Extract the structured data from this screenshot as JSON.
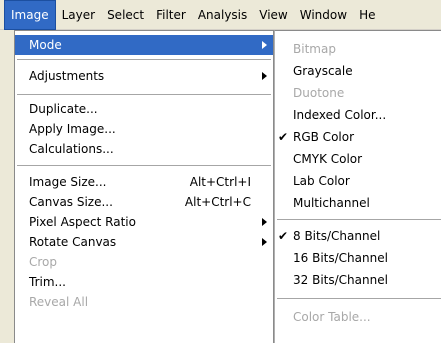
{
  "menubar": {
    "items": [
      "Image",
      "Layer",
      "Select",
      "Filter",
      "Analysis",
      "View",
      "Window",
      "He"
    ]
  },
  "image_menu": {
    "items": [
      {
        "label": "Mode"
      },
      {
        "label": "Adjustments"
      },
      {
        "label": "Duplicate..."
      },
      {
        "label": "Apply Image..."
      },
      {
        "label": "Calculations..."
      },
      {
        "label": "Image Size...",
        "shortcut": "Alt+Ctrl+I"
      },
      {
        "label": "Canvas Size...",
        "shortcut": "Alt+Ctrl+C"
      },
      {
        "label": "Pixel Aspect Ratio"
      },
      {
        "label": "Rotate Canvas"
      },
      {
        "label": "Crop"
      },
      {
        "label": "Trim..."
      },
      {
        "label": "Reveal All"
      }
    ]
  },
  "mode_submenu": {
    "items": [
      {
        "label": "Bitmap"
      },
      {
        "label": "Grayscale"
      },
      {
        "label": "Duotone"
      },
      {
        "label": "Indexed Color..."
      },
      {
        "label": "RGB Color"
      },
      {
        "label": "CMYK Color"
      },
      {
        "label": "Lab Color"
      },
      {
        "label": "Multichannel"
      },
      {
        "label": "8 Bits/Channel"
      },
      {
        "label": "16 Bits/Channel"
      },
      {
        "label": "32 Bits/Channel"
      },
      {
        "label": "Color Table..."
      }
    ],
    "check_glyph": "✔"
  },
  "colors": {
    "highlight": "#316ac5",
    "disabled_text": "#a8a8a8"
  }
}
